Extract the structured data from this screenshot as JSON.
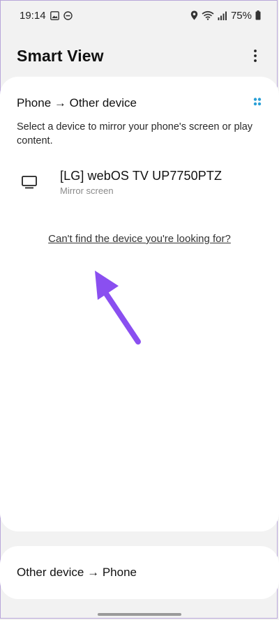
{
  "status_bar": {
    "time": "19:14",
    "battery_percent": "75%",
    "icons_left": [
      "gallery-icon",
      "dnd-icon"
    ],
    "icons_right": [
      "location-icon",
      "wifi-icon",
      "signal-icon",
      "battery-icon"
    ]
  },
  "header": {
    "title": "Smart View",
    "more_icon": "more-vert-icon"
  },
  "main": {
    "section_title": "Phone → Other device",
    "instructions": "Select a device to mirror your phone's screen or play content.",
    "devices": [
      {
        "name": "[LG] webOS TV UP7750PTZ",
        "subtitle": "Mirror screen",
        "icon": "tv-icon"
      }
    ],
    "help_link": "Can't find the device you're looking for?"
  },
  "bottom": {
    "label": "Other device → Phone"
  },
  "colors": {
    "background": "#f2f2f2",
    "card": "#ffffff",
    "arrow": "#8a4ff0",
    "cast_dots": "#2a9fd6"
  }
}
